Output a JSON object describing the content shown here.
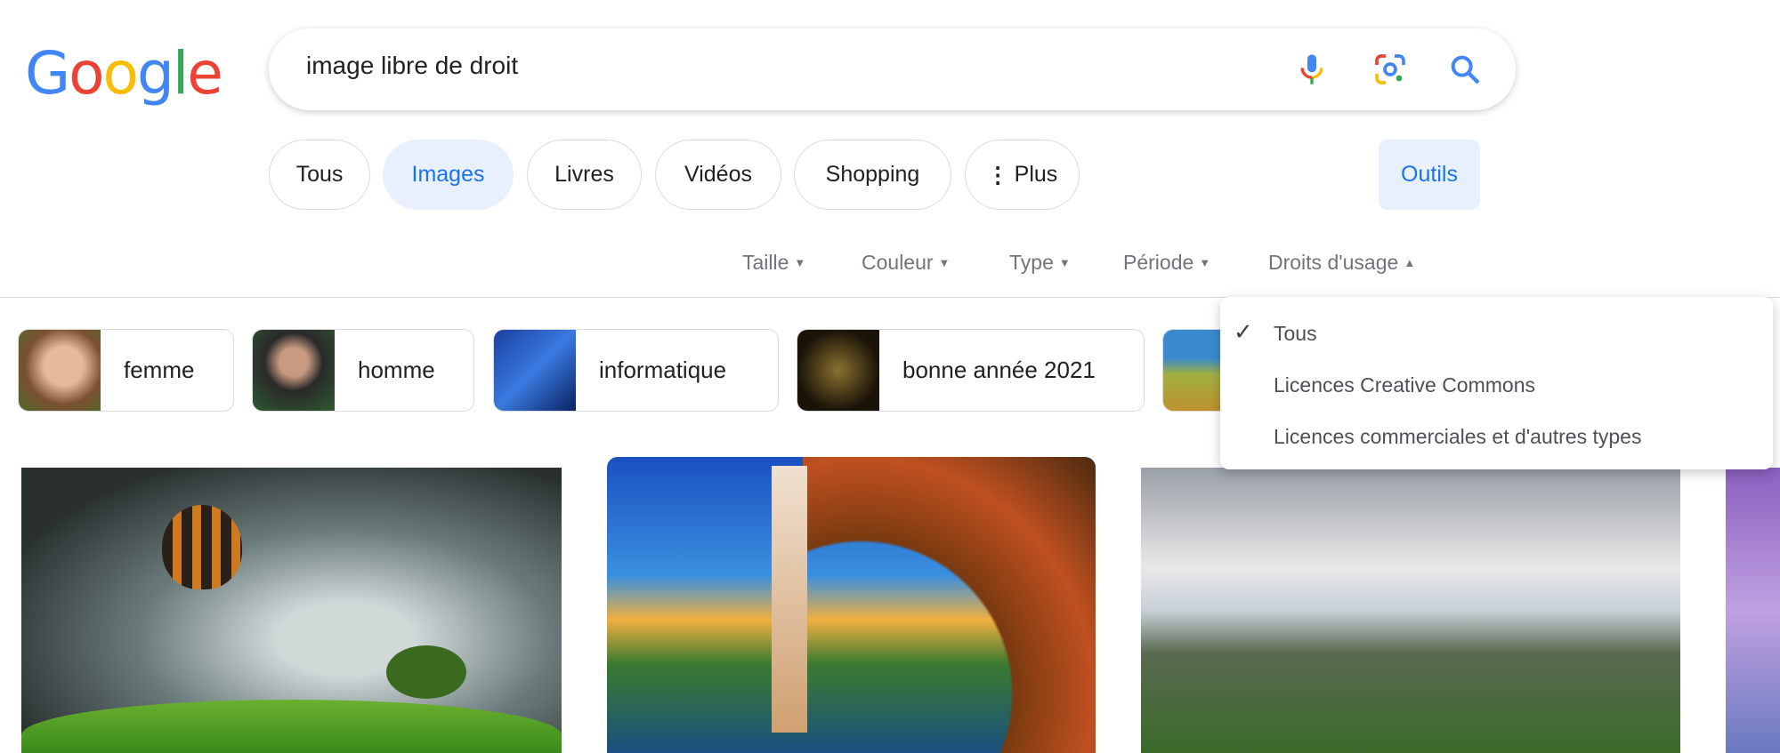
{
  "logo": {
    "text": "Google",
    "letters": [
      {
        "c": "G",
        "color": "#4285f4"
      },
      {
        "c": "o",
        "color": "#ea4335"
      },
      {
        "c": "o",
        "color": "#fbbc05"
      },
      {
        "c": "g",
        "color": "#4285f4"
      },
      {
        "c": "l",
        "color": "#34a853"
      },
      {
        "c": "e",
        "color": "#ea4335"
      }
    ]
  },
  "search": {
    "query": "image libre de droit",
    "icons": [
      "microphone-icon",
      "google-lens-icon",
      "search-icon"
    ]
  },
  "tabs": [
    {
      "label": "Tous"
    },
    {
      "label": "Images",
      "active": true
    },
    {
      "label": "Livres"
    },
    {
      "label": "Vidéos"
    },
    {
      "label": "Shopping"
    },
    {
      "label": "Plus",
      "icon": "more-vert-icon"
    }
  ],
  "tools_button": "Outils",
  "tools": [
    {
      "label": "Taille"
    },
    {
      "label": "Couleur"
    },
    {
      "label": "Type"
    },
    {
      "label": "Période"
    },
    {
      "label": "Droits d'usage",
      "open": true
    }
  ],
  "chips": [
    {
      "label": "femme"
    },
    {
      "label": "homme"
    },
    {
      "label": "informatique"
    },
    {
      "label": "bonne année 2021"
    }
  ],
  "usage_rights_menu": {
    "selected": "Tous",
    "items": [
      "Tous",
      "Licences Creative Commons",
      "Licences commerciales et d'autres types"
    ]
  },
  "colors": {
    "accent": "#1a73e8",
    "active_bg": "#e8f0fe"
  }
}
